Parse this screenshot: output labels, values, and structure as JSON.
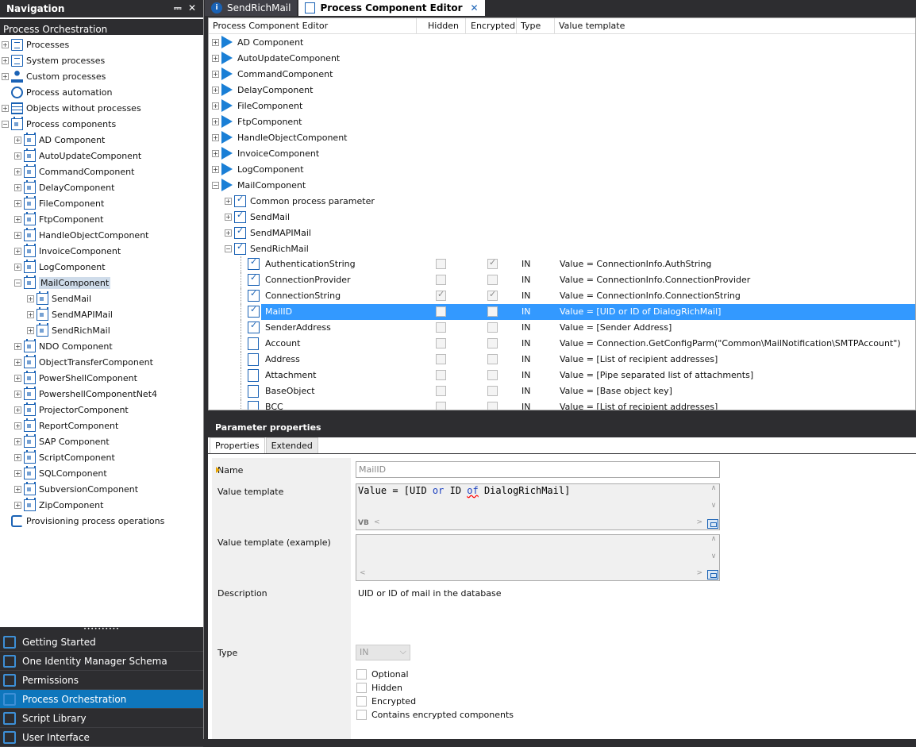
{
  "navigation": {
    "title": "Navigation",
    "pin_glyph": "⎓",
    "close_glyph": "✕",
    "section": "Process Orchestration",
    "tree": [
      {
        "label": "Processes",
        "level": 0,
        "icon": "doc"
      },
      {
        "label": "System processes",
        "level": 0,
        "icon": "doc"
      },
      {
        "label": "Custom processes",
        "level": 0,
        "icon": "user"
      },
      {
        "label": "Process automation",
        "level": 0,
        "icon": "gear"
      },
      {
        "label": "Objects without processes",
        "level": 0,
        "icon": "grid"
      },
      {
        "label": "Process components",
        "level": 0,
        "icon": "cal"
      },
      {
        "label": "AD Component",
        "level": 1,
        "icon": "cal"
      },
      {
        "label": "AutoUpdateComponent",
        "level": 1,
        "icon": "cal"
      },
      {
        "label": "CommandComponent",
        "level": 1,
        "icon": "cal"
      },
      {
        "label": "DelayComponent",
        "level": 1,
        "icon": "cal"
      },
      {
        "label": "FileComponent",
        "level": 1,
        "icon": "cal"
      },
      {
        "label": "FtpComponent",
        "level": 1,
        "icon": "cal"
      },
      {
        "label": "HandleObjectComponent",
        "level": 1,
        "icon": "cal"
      },
      {
        "label": "InvoiceComponent",
        "level": 1,
        "icon": "cal"
      },
      {
        "label": "LogComponent",
        "level": 1,
        "icon": "cal"
      },
      {
        "label": "MailComponent",
        "level": 1,
        "icon": "cal"
      },
      {
        "label": "SendMail",
        "level": 2,
        "icon": "cal"
      },
      {
        "label": "SendMAPIMail",
        "level": 2,
        "icon": "cal"
      },
      {
        "label": "SendRichMail",
        "level": 2,
        "icon": "cal"
      },
      {
        "label": "NDO Component",
        "level": 1,
        "icon": "cal"
      },
      {
        "label": "ObjectTransferComponent",
        "level": 1,
        "icon": "cal"
      },
      {
        "label": "PowerShellComponent",
        "level": 1,
        "icon": "cal"
      },
      {
        "label": "PowershellComponentNet4",
        "level": 1,
        "icon": "cal"
      },
      {
        "label": "ProjectorComponent",
        "level": 1,
        "icon": "cal"
      },
      {
        "label": "ReportComponent",
        "level": 1,
        "icon": "cal"
      },
      {
        "label": "SAP Component",
        "level": 1,
        "icon": "cal"
      },
      {
        "label": "ScriptComponent",
        "level": 1,
        "icon": "cal"
      },
      {
        "label": "SQLComponent",
        "level": 1,
        "icon": "cal"
      },
      {
        "label": "SubversionComponent",
        "level": 1,
        "icon": "cal"
      },
      {
        "label": "ZipComponent",
        "level": 1,
        "icon": "cal"
      },
      {
        "label": "Provisioning process operations",
        "level": 0,
        "icon": "sync"
      }
    ],
    "selected_item": "MailComponent",
    "splitter_glyph": "••••••••••",
    "modules": [
      {
        "label": "Getting Started",
        "active": false
      },
      {
        "label": "One Identity Manager Schema",
        "active": false
      },
      {
        "label": "Permissions",
        "active": false
      },
      {
        "label": "Process Orchestration",
        "active": true
      },
      {
        "label": "Script Library",
        "active": false
      },
      {
        "label": "User Interface",
        "active": false
      }
    ]
  },
  "tabs": {
    "tab1": "SendRichMail",
    "tab1_icon": "i",
    "tab2": "Process Component Editor",
    "close_glyph": "✕"
  },
  "editor": {
    "columns": {
      "name": "Process Component Editor",
      "hidden": "Hidden",
      "encrypted": "Encrypted",
      "type": "Type",
      "value": "Value template"
    },
    "components": [
      "AD Component",
      "AutoUpdateComponent",
      "CommandComponent",
      "DelayComponent",
      "FileComponent",
      "FtpComponent",
      "HandleObjectComponent",
      "InvoiceComponent",
      "LogComponent",
      "MailComponent"
    ],
    "mail_children": [
      "Common process parameter",
      "SendMail",
      "SendMAPIMail",
      "SendRichMail"
    ],
    "parameters": [
      {
        "name": "AuthenticationString",
        "hidden": false,
        "encrypted": true,
        "type": "IN",
        "value": "Value = ConnectionInfo.AuthString",
        "icon": "check"
      },
      {
        "name": "ConnectionProvider",
        "hidden": false,
        "encrypted": false,
        "type": "IN",
        "value": "Value = ConnectionInfo.ConnectionProvider",
        "icon": "check"
      },
      {
        "name": "ConnectionString",
        "hidden": true,
        "encrypted": true,
        "type": "IN",
        "value": "Value = ConnectionInfo.ConnectionString",
        "icon": "check"
      },
      {
        "name": "MailID",
        "hidden": false,
        "encrypted": false,
        "type": "IN",
        "value": "Value = [UID or ID of DialogRichMail]",
        "icon": "check",
        "selected": true
      },
      {
        "name": "SenderAddress",
        "hidden": false,
        "encrypted": false,
        "type": "IN",
        "value": "Value = [Sender Address]",
        "icon": "check"
      },
      {
        "name": "Account",
        "hidden": false,
        "encrypted": false,
        "type": "IN",
        "value": "Value = Connection.GetConfigParm(\"Common\\MailNotification\\SMTPAccount\")",
        "icon": "doc"
      },
      {
        "name": "Address",
        "hidden": false,
        "encrypted": false,
        "type": "IN",
        "value": "Value = [List of recipient addresses]",
        "icon": "doc"
      },
      {
        "name": "Attachment",
        "hidden": false,
        "encrypted": false,
        "type": "IN",
        "value": "Value = [Pipe separated list of attachments]",
        "icon": "doc"
      },
      {
        "name": "BaseObject",
        "hidden": false,
        "encrypted": false,
        "type": "IN",
        "value": "Value = [Base object key]",
        "icon": "doc"
      },
      {
        "name": "BCC",
        "hidden": false,
        "encrypted": false,
        "type": "IN",
        "value": "Value = [List of recipient addresses]",
        "icon": "doc"
      }
    ]
  },
  "properties": {
    "header": "Parameter properties",
    "tab_properties": "Properties",
    "tab_extended": "Extended",
    "name_label": "Name",
    "name_value": "MailID",
    "value_template_label": "Value template",
    "vt_part1": "Value = [UID ",
    "vt_or": "or",
    "vt_part2": " ID ",
    "vt_of": "of",
    "vt_part3": " DialogRichMail]",
    "vb_badge": "VB",
    "example_label": "Value template (example)",
    "description_label": "Description",
    "description_value": "UID or ID of mail in the database",
    "type_label": "Type",
    "type_value": "IN",
    "options": [
      "Optional",
      "Hidden",
      "Encrypted",
      "Contains encrypted components"
    ]
  }
}
